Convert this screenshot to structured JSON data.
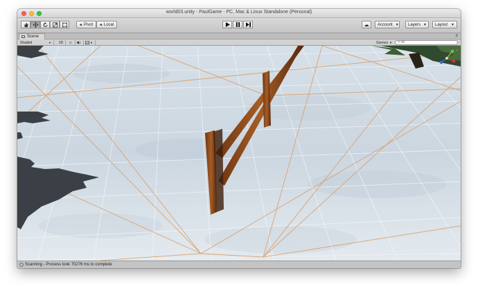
{
  "window": {
    "title": "world03.unity - PaulGame - PC, Mac & Linux Standalone (Personal)"
  },
  "toolbar": {
    "tools": [
      "hand-tool",
      "move-tool",
      "rotate-tool",
      "scale-tool",
      "rect-tool"
    ],
    "pivot_label": "Pivot",
    "local_label": "Local",
    "account_label": "Account",
    "layers_label": "Layers",
    "layout_label": "Layout"
  },
  "scene_tab": {
    "label": "Scene"
  },
  "scene_toolbar": {
    "shading_mode": "Shaded",
    "mode_2d": "2D",
    "gizmos_label": "Gizmos",
    "search_placeholder": "All"
  },
  "status": {
    "text": "Scanning - Process took 70276 ms to complete"
  },
  "colors": {
    "accent_gizmo_x": "#d23a2f",
    "accent_gizmo_y": "#7bbf3c",
    "accent_gizmo_z": "#3d6fd1",
    "fence": "#8a4a1c"
  }
}
